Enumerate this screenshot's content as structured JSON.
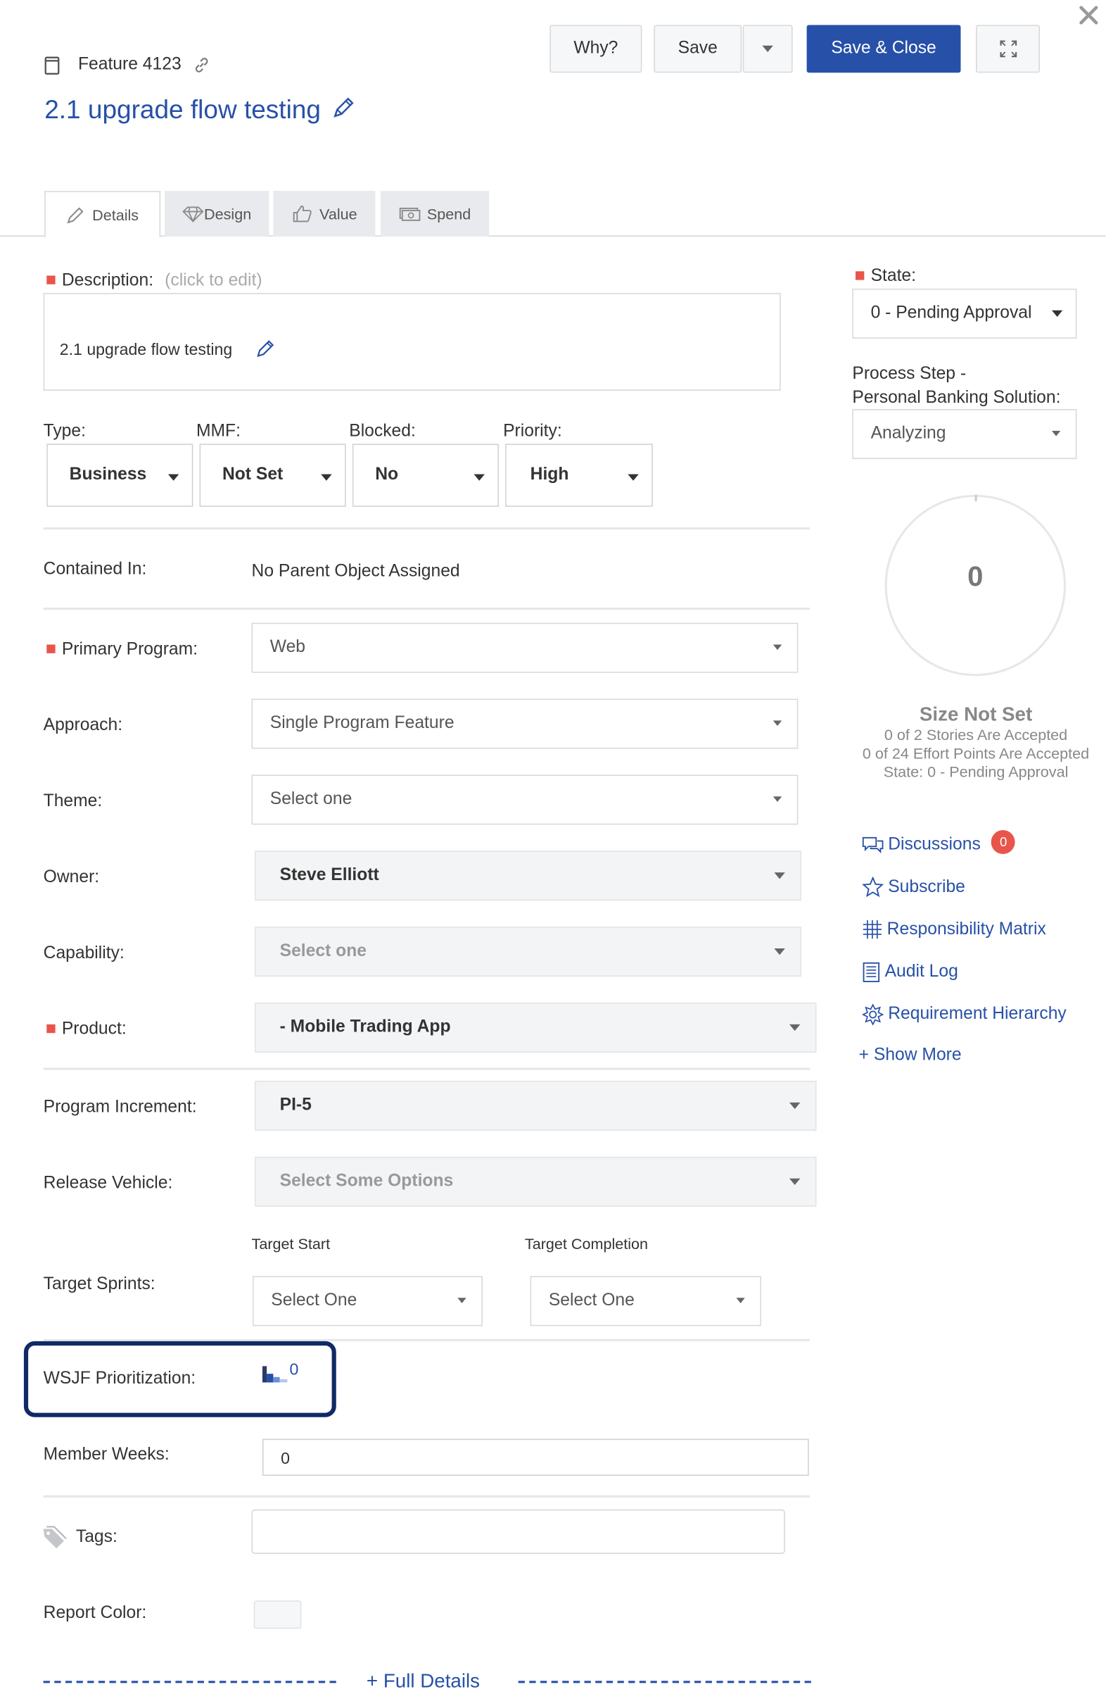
{
  "header": {
    "item_id": "Feature 4123",
    "title": "2.1 upgrade flow testing",
    "buttons": {
      "why": "Why?",
      "save": "Save",
      "save_close": "Save & Close"
    }
  },
  "tabs": [
    {
      "label": "Details",
      "icon": "pencil-icon",
      "active": true
    },
    {
      "label": "Design",
      "icon": "diamond-icon"
    },
    {
      "label": "Value",
      "icon": "thumbs-up-icon"
    },
    {
      "label": "Spend",
      "icon": "money-icon"
    }
  ],
  "description": {
    "label": "Description:",
    "hint": "(click to edit)",
    "value": "2.1 upgrade flow testing"
  },
  "dropdown_row": [
    {
      "label": "Type:",
      "value": "Business"
    },
    {
      "label": "MMF:",
      "value": "Not Set"
    },
    {
      "label": "Blocked:",
      "value": "No"
    },
    {
      "label": "Priority:",
      "value": "High"
    }
  ],
  "contained_in": {
    "label": "Contained In:",
    "value": "No Parent Object Assigned"
  },
  "fields": {
    "primary_program": {
      "label": "Primary Program:",
      "value": "Web"
    },
    "approach": {
      "label": "Approach:",
      "value": "Single Program Feature"
    },
    "theme": {
      "label": "Theme:",
      "value": "Select one"
    },
    "owner": {
      "label": "Owner:",
      "value": "Steve Elliott"
    },
    "capability": {
      "label": "Capability:",
      "value": "Select one"
    },
    "product": {
      "label": "Product:",
      "value": "- Mobile Trading App"
    },
    "program_increment": {
      "label": "Program Increment:",
      "value": "PI-5"
    },
    "release_vehicle": {
      "label": "Release Vehicle:",
      "value": "Select Some Options"
    },
    "target_sprints": {
      "label": "Target Sprints:",
      "start_label": "Target Start",
      "start_value": "Select One",
      "completion_label": "Target Completion",
      "completion_value": "Select One"
    },
    "wsjf": {
      "label": "WSJF Prioritization:",
      "value": "0"
    },
    "member_weeks": {
      "label": "Member Weeks:",
      "value": "0"
    },
    "tags": {
      "label": "Tags:",
      "value": ""
    },
    "report_color": {
      "label": "Report Color:"
    }
  },
  "full_details_link": "+ Full Details",
  "sidebar": {
    "state": {
      "label": "State:",
      "value": "0 - Pending Approval"
    },
    "process_step": {
      "label_line1": "Process Step -",
      "label_line2": "Personal Banking Solution:",
      "value": "Analyzing"
    },
    "size": {
      "value": "0",
      "title": "Size Not Set",
      "stories": "0 of 2 Stories Are Accepted",
      "points": "0 of 24 Effort Points Are Accepted",
      "state": "State: 0 - Pending Approval"
    },
    "links": [
      {
        "label": "Discussions",
        "icon": "discussion-icon",
        "badge": "0"
      },
      {
        "label": "Subscribe",
        "icon": "star-icon"
      },
      {
        "label": "Responsibility Matrix",
        "icon": "grid-icon"
      },
      {
        "label": "Audit Log",
        "icon": "document-icon"
      },
      {
        "label": "Requirement Hierarchy",
        "icon": "hierarchy-icon"
      },
      {
        "label": "+ Show More"
      }
    ]
  },
  "colors": {
    "primary": "#2750a8",
    "required": "#e8554a",
    "highlight_border": "#0f2a66",
    "badge": "#e8554a"
  }
}
